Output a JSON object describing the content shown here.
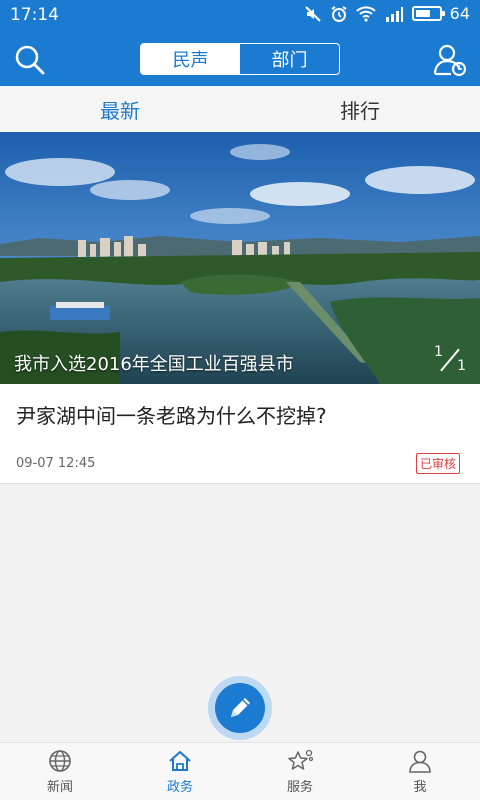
{
  "status_bar": {
    "time": "17:14",
    "battery_level": "64",
    "battery_fraction": 0.64
  },
  "header": {
    "segments": [
      {
        "label": "民声",
        "active": true
      },
      {
        "label": "部门",
        "active": false
      }
    ],
    "search_icon": "search-icon",
    "users_icon": "users-icon"
  },
  "subtabs": [
    {
      "label": "最新",
      "active": true
    },
    {
      "label": "排行",
      "active": false
    }
  ],
  "banner": {
    "caption": "我市入选2016年全国工业百强县市",
    "page_current": "1",
    "page_total": "1"
  },
  "posts": [
    {
      "title": "尹家湖中间一条老路为什么不挖掉?",
      "time": "09-07 12:45",
      "badge": "已审核"
    }
  ],
  "fab": {
    "icon": "pencil-icon"
  },
  "bottom_nav": [
    {
      "label": "新闻",
      "icon": "globe-icon",
      "active": false
    },
    {
      "label": "政务",
      "icon": "home-icon",
      "active": true
    },
    {
      "label": "服务",
      "icon": "star-icon",
      "active": false
    },
    {
      "label": "我",
      "icon": "person-icon",
      "active": false
    }
  ],
  "colors": {
    "primary": "#1a7bd0",
    "badge_red": "#e04040",
    "background": "#f2f2f2"
  }
}
